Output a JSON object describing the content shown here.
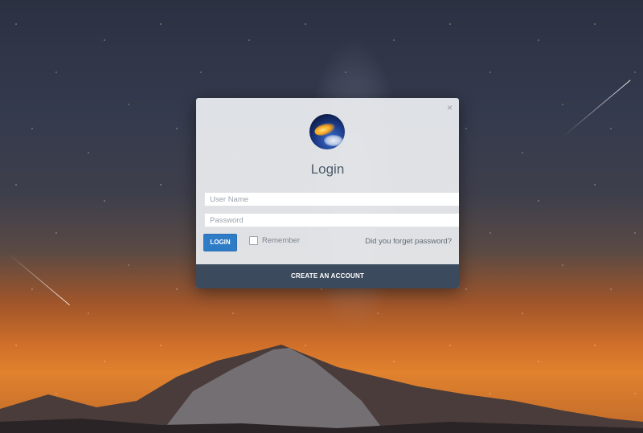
{
  "modal": {
    "close_glyph": "×",
    "title": "Login",
    "username": {
      "placeholder": "User Name",
      "value": ""
    },
    "password": {
      "placeholder": "Password",
      "value": ""
    },
    "login_label": "LOGIN",
    "remember_label": "Remember",
    "remember_checked": false,
    "forgot_label": "Did you forget password?",
    "create_account_label": "CREATE AN ACCOUNT",
    "icons": {
      "avatar": "avatar-logo-icon",
      "close": "close-icon"
    }
  },
  "colors": {
    "primary_button": "#2f7cc6",
    "footer_bar": "#3b4a5c",
    "title_text": "#4d5b6a"
  }
}
